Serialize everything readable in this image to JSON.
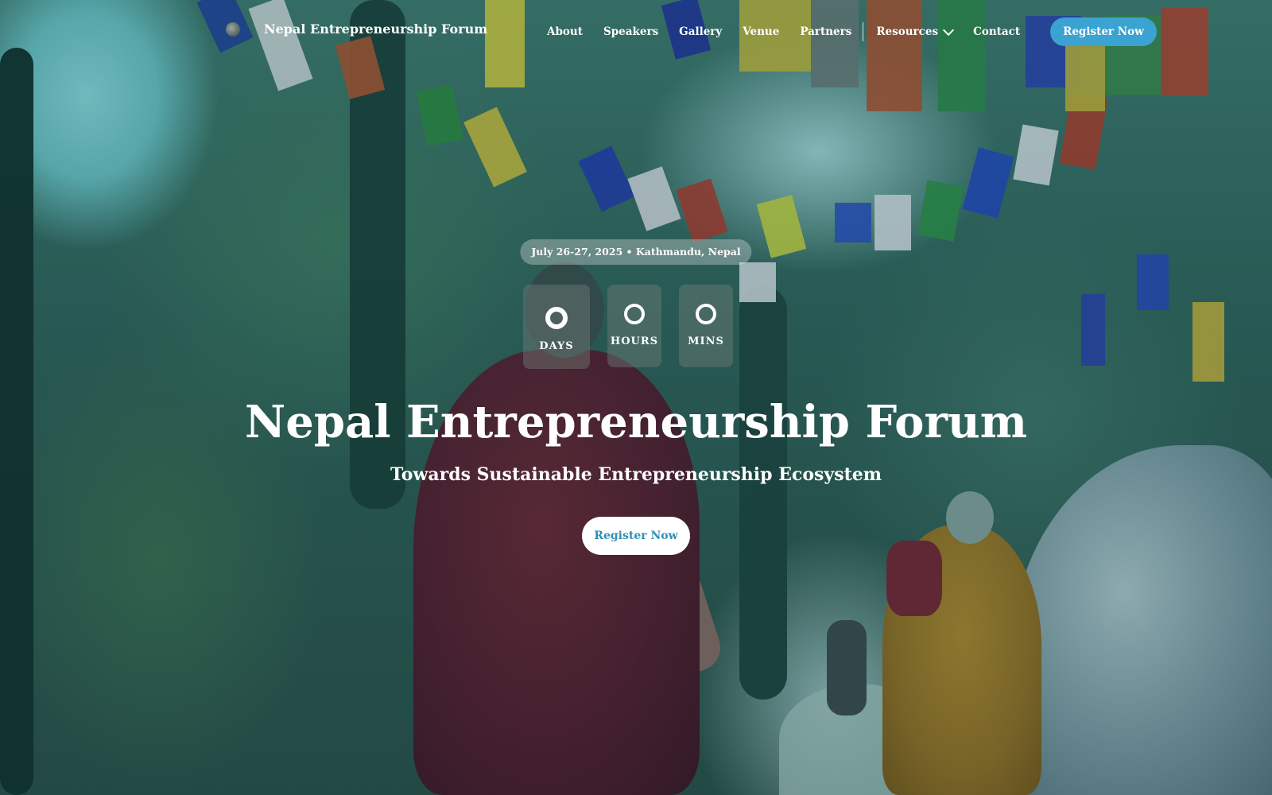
{
  "brand": {
    "name": "Nepal Entrepreneurship Forum",
    "logo_icon": "logo-icon"
  },
  "nav": {
    "items": [
      {
        "label": "About"
      },
      {
        "label": "Speakers"
      },
      {
        "label": "Gallery"
      },
      {
        "label": "Venue"
      },
      {
        "label": "Partners"
      }
    ],
    "resources_label": "Resources",
    "contact_label": "Contact",
    "register_label": "Register Now"
  },
  "hero": {
    "date_location": "July 26-27, 2025 • Kathmandu, Nepal",
    "countdown": [
      {
        "value": "0",
        "label": "DAYS"
      },
      {
        "value": "0",
        "label": "HOURS"
      },
      {
        "value": "0",
        "label": "MINS"
      }
    ],
    "title": "Nepal Entrepreneurship Forum",
    "subtitle": "Towards Sustainable Entrepreneurship Ecosystem",
    "register_label": "Register Now"
  },
  "colors": {
    "accent": "#3aa3d1",
    "button_text": "#2f8fb8",
    "text": "#ffffff"
  }
}
